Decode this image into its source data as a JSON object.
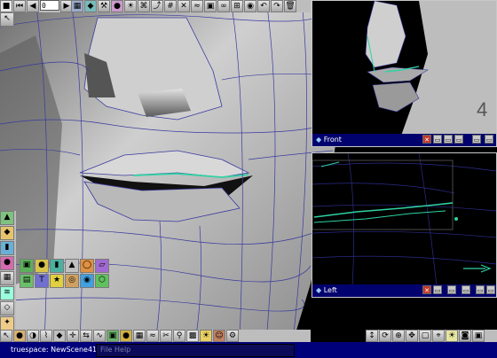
{
  "toolbar": {
    "frame_value": "0",
    "buttons": [
      "record-icon",
      "rewind-icon",
      "prev-key-icon",
      "play-icon",
      "next-key-icon",
      "end-icon",
      "render-icon",
      "edit-icon"
    ]
  },
  "viewports": {
    "front": {
      "title": "Front",
      "number_overlay": "4"
    },
    "left": {
      "title": "Left"
    }
  },
  "statusbar": {
    "title": "truespace: NewScene41",
    "menu": [
      "File",
      "Help"
    ]
  },
  "colors": {
    "status_bar": "#00007a",
    "viewport_bg": "#000000",
    "wire": "#3a3aa0",
    "selected_edge": "#2fd3a3"
  }
}
